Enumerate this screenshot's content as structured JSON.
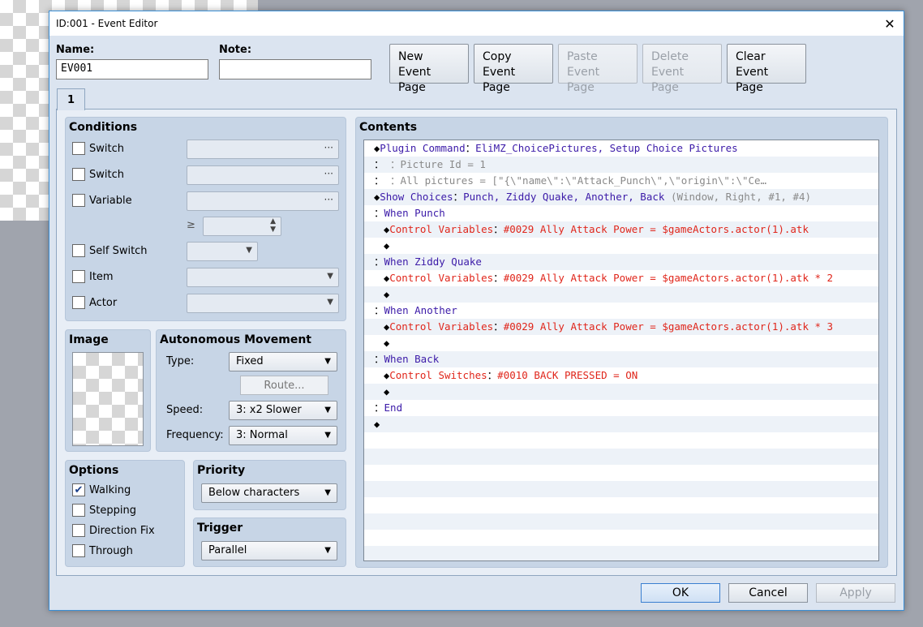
{
  "window": {
    "title": "ID:001 - Event Editor",
    "close_glyph": "✕"
  },
  "header": {
    "name_label": "Name:",
    "name_value": "EV001",
    "note_label": "Note:",
    "note_value": ""
  },
  "page_buttons": [
    {
      "line1": "New",
      "line2": "Event Page",
      "enabled": true
    },
    {
      "line1": "Copy",
      "line2": "Event Page",
      "enabled": true
    },
    {
      "line1": "Paste",
      "line2": "Event Page",
      "enabled": false
    },
    {
      "line1": "Delete",
      "line2": "Event Page",
      "enabled": false
    },
    {
      "line1": "Clear",
      "line2": "Event Page",
      "enabled": true
    }
  ],
  "tabs": [
    {
      "label": "1"
    }
  ],
  "conditions": {
    "title": "Conditions",
    "switch1": "Switch",
    "switch2": "Switch",
    "variable": "Variable",
    "gte": "≥",
    "self_switch": "Self Switch",
    "item": "Item",
    "actor": "Actor",
    "dots": "···"
  },
  "image": {
    "title": "Image"
  },
  "movement": {
    "title": "Autonomous Movement",
    "type_label": "Type:",
    "type_value": "Fixed",
    "route_label": "Route...",
    "speed_label": "Speed:",
    "speed_value": "3: x2 Slower",
    "frequency_label": "Frequency:",
    "frequency_value": "3: Normal"
  },
  "options": {
    "title": "Options",
    "walking": "Walking",
    "stepping": "Stepping",
    "direction_fix": "Direction Fix",
    "through": "Through",
    "check_glyph": "✔"
  },
  "priority": {
    "title": "Priority",
    "value": "Below characters"
  },
  "trigger": {
    "title": "Trigger",
    "value": "Parallel"
  },
  "contents": {
    "title": "Contents",
    "lines": [
      {
        "indent": 0,
        "diamond": "◆",
        "cmd": "Plugin Command",
        "sep": "：",
        "text": "EliMZ_ChoicePictures, Setup Choice Pictures",
        "cmd_color": "purple",
        "text_color": "purple"
      },
      {
        "indent": 0,
        "diamond": "",
        "cmd": "：",
        "sep": "",
        "text": "              ：Picture Id = 1",
        "cmd_color": "black",
        "text_color": "gray"
      },
      {
        "indent": 0,
        "diamond": "",
        "cmd": "：",
        "sep": "",
        "text": "              ：All pictures = [\"{\\\"name\\\":\\\"Attack_Punch\\\",\\\"origin\\\":\\\"Ce…",
        "cmd_color": "black",
        "text_color": "gray"
      },
      {
        "indent": 0,
        "diamond": "◆",
        "cmd": "Show Choices",
        "sep": "：",
        "text": "Punch, Ziddy Quake, Another, Back",
        "extra": " (Window, Right, #1, #4)",
        "cmd_color": "purple",
        "text_color": "purple"
      },
      {
        "indent": 0,
        "diamond": "",
        "cmd": "：",
        "sep": "",
        "text": "When Punch",
        "cmd_color": "black",
        "text_color": "purple"
      },
      {
        "indent": 1,
        "diamond": "◆",
        "cmd": "Control Variables",
        "sep": "：",
        "text": "#0029 Ally Attack Power = $gameActors.actor(1).atk",
        "cmd_color": "red",
        "text_color": "red"
      },
      {
        "indent": 1,
        "diamond": "◆",
        "cmd": "",
        "sep": "",
        "text": "",
        "cmd_color": "black",
        "text_color": "black"
      },
      {
        "indent": 0,
        "diamond": "",
        "cmd": "：",
        "sep": "",
        "text": "When Ziddy Quake",
        "cmd_color": "black",
        "text_color": "purple"
      },
      {
        "indent": 1,
        "diamond": "◆",
        "cmd": "Control Variables",
        "sep": "：",
        "text": "#0029 Ally Attack Power = $gameActors.actor(1).atk * 2",
        "cmd_color": "red",
        "text_color": "red"
      },
      {
        "indent": 1,
        "diamond": "◆",
        "cmd": "",
        "sep": "",
        "text": "",
        "cmd_color": "black",
        "text_color": "black"
      },
      {
        "indent": 0,
        "diamond": "",
        "cmd": "：",
        "sep": "",
        "text": "When Another",
        "cmd_color": "black",
        "text_color": "purple"
      },
      {
        "indent": 1,
        "diamond": "◆",
        "cmd": "Control Variables",
        "sep": "：",
        "text": "#0029 Ally Attack Power = $gameActors.actor(1).atk * 3",
        "cmd_color": "red",
        "text_color": "red"
      },
      {
        "indent": 1,
        "diamond": "◆",
        "cmd": "",
        "sep": "",
        "text": "",
        "cmd_color": "black",
        "text_color": "black"
      },
      {
        "indent": 0,
        "diamond": "",
        "cmd": "：",
        "sep": "",
        "text": "When Back",
        "cmd_color": "black",
        "text_color": "purple"
      },
      {
        "indent": 1,
        "diamond": "◆",
        "cmd": "Control Switches",
        "sep": "：",
        "text": "#0010 BACK PRESSED = ON",
        "cmd_color": "red",
        "text_color": "red"
      },
      {
        "indent": 1,
        "diamond": "◆",
        "cmd": "",
        "sep": "",
        "text": "",
        "cmd_color": "black",
        "text_color": "black"
      },
      {
        "indent": 0,
        "diamond": "",
        "cmd": "：",
        "sep": "",
        "text": "End",
        "cmd_color": "black",
        "text_color": "purple"
      },
      {
        "indent": 0,
        "diamond": "◆",
        "cmd": "",
        "sep": "",
        "text": "",
        "cmd_color": "black",
        "text_color": "black"
      }
    ]
  },
  "footer": {
    "ok": "OK",
    "cancel": "Cancel",
    "apply": "Apply"
  }
}
